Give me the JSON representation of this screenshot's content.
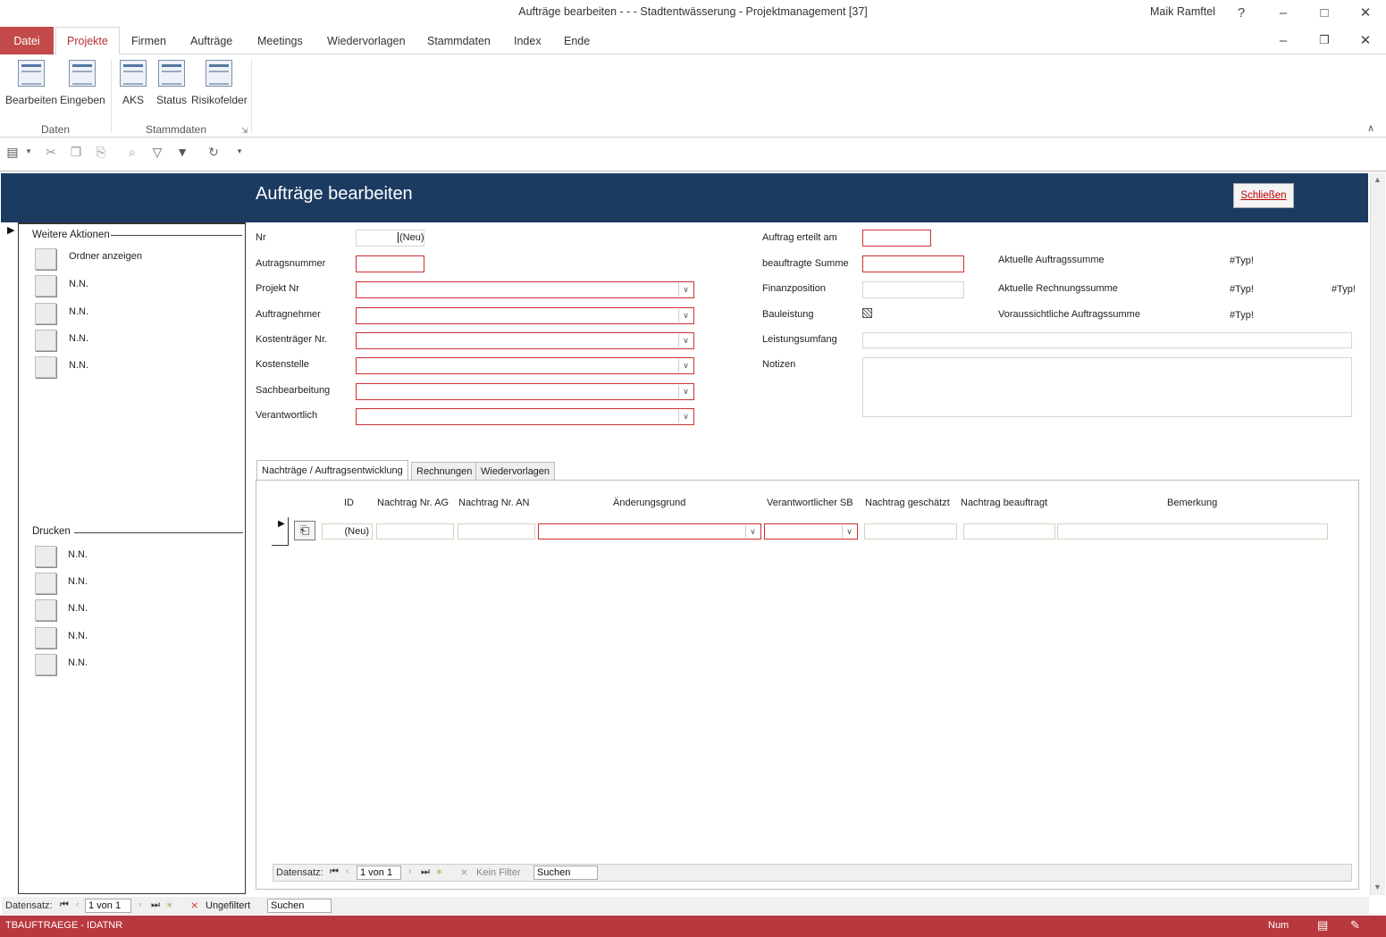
{
  "window": {
    "title": "Aufträge bearbeiten -  -  - Stadtentwässerung - Projektmanagement [37]",
    "user": "Maik Ramftel",
    "help": "?"
  },
  "menu": {
    "tabs": [
      "Datei",
      "Projekte",
      "Firmen",
      "Aufträge",
      "Meetings",
      "Wiedervorlagen",
      "Stammdaten",
      "Index",
      "Ende"
    ]
  },
  "ribbon": {
    "buttons": [
      "Bearbeiten",
      "Eingeben",
      "AKS",
      "Status",
      "Risikofelder"
    ],
    "groups": [
      "Daten",
      "Stammdaten"
    ]
  },
  "form": {
    "title": "Aufträge bearbeiten",
    "close_label": "Schließen"
  },
  "left_panel": {
    "actions_title": "Weitere Aktionen",
    "actions": [
      "Ordner anzeigen",
      "N.N.",
      "N.N.",
      "N.N.",
      "N.N."
    ],
    "print_title": "Drucken",
    "print": [
      "N.N.",
      "N.N.",
      "N.N.",
      "N.N.",
      "N.N."
    ]
  },
  "fields_left": {
    "nr": "Nr",
    "nr_value": "(Neu)",
    "auftragsnummer": "Autragsnummer",
    "projekt_nr": "Projekt Nr",
    "auftragnehmer": "Auftragnehmer",
    "kostentraeger": "Kostenträger Nr.",
    "kostenstelle": "Kostenstelle",
    "sachbearbeitung": "Sachbearbeitung",
    "verantwortlich": "Verantwortlich"
  },
  "fields_right": {
    "auftrag_erteilt": "Auftrag erteilt am",
    "beauftragte_summe": "beauftragte Summe",
    "finanzposition": "Finanzposition",
    "bauleistung": "Bauleistung",
    "leistungsumfang": "Leistungsumfang",
    "notizen": "Notizen"
  },
  "sums": {
    "aktuelle_auftragssumme": "Aktuelle Auftragssumme",
    "aktuelle_auftragssumme_val": "#Typ!",
    "aktuelle_rechnungssumme": "Aktuelle Rechnungssumme",
    "aktuelle_rechnungssumme_val": "#Typ!",
    "aktuelle_rechnungssumme_val2": "#Typ!",
    "voraussichtliche": "Voraussichtliche Auftragssumme",
    "voraussichtliche_val": "#Typ!"
  },
  "tabs": [
    "Nachträge / Auftragsentwicklung",
    "Rechnungen",
    "Wiedervorlagen"
  ],
  "subform": {
    "columns": [
      "ID",
      "Nachtrag Nr. AG",
      "Nachtrag Nr. AN",
      "Änderungsgrund",
      "Verantwortlicher SB",
      "Nachtrag geschätzt",
      "Nachtrag beauftragt",
      "Bemerkung"
    ],
    "id_value": "(Neu)"
  },
  "nav_sub": {
    "label": "Datensatz:",
    "record": "1 von 1",
    "filter": "Kein Filter",
    "search": "Suchen"
  },
  "nav_main": {
    "label": "Datensatz:",
    "record": "1 von 1",
    "filter": "Ungefiltert",
    "search": "Suchen"
  },
  "status": {
    "left": "TBAUFTRAEGE - IDATNR",
    "num": "Num"
  }
}
